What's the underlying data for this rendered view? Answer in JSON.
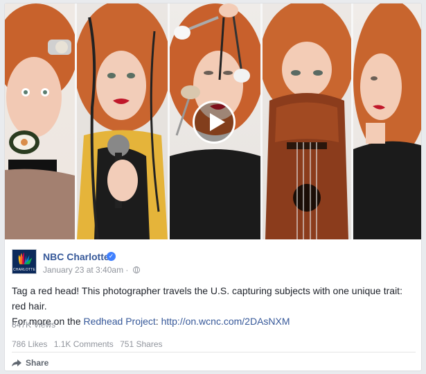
{
  "post": {
    "page_name": "NBC Charlotte",
    "verified_glyph": "✓",
    "timestamp": "January 23 at 3:40am",
    "separator": " · ",
    "avatar_label": "CHARLOTTE",
    "text_line1": "Tag a red head! This photographer travels the U.S. capturing subjects with one unique trait: red hair.",
    "text_line2_prefix": "For more on the ",
    "text_link1": "Redhead Project",
    "text_mid": ": ",
    "text_link2": "http://on.wcnc.com/2DAsNXM",
    "views": "847K Views",
    "likes": "786 Likes",
    "comments": "1.1K Comments",
    "shares": "751 Shares",
    "share_label": "Share"
  },
  "icons": {
    "verified": "verified-check-icon",
    "globe": "globe-icon",
    "share": "share-arrow-icon",
    "play": "play-icon"
  },
  "colors": {
    "link": "#365899",
    "muted": "#90949c",
    "verified": "#4080ff",
    "hair": "#c8622c",
    "lips": "#c0172a"
  }
}
